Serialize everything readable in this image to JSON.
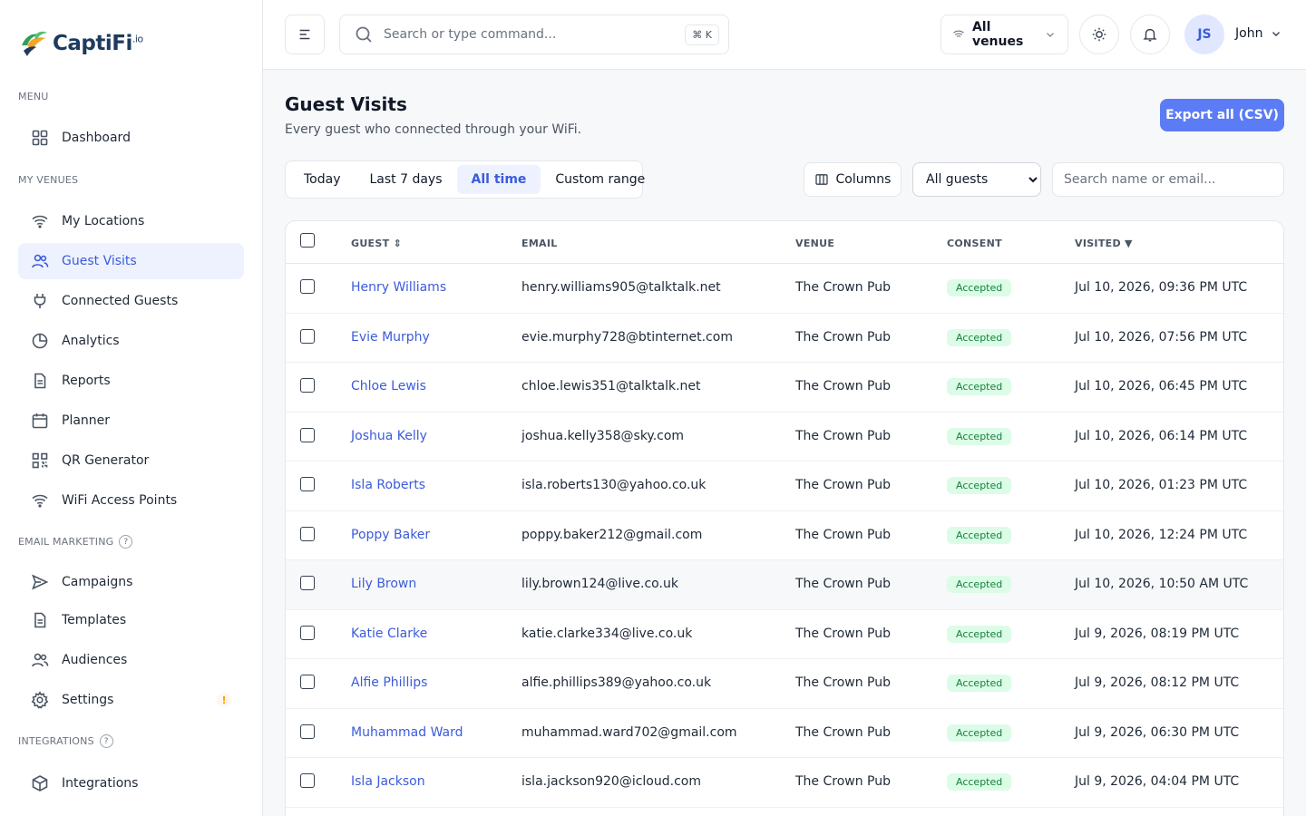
{
  "brand": {
    "name": "CaptiFi",
    "suffix": ".io"
  },
  "sidebar": {
    "menu_label": "MENU",
    "venues_label": "MY VENUES",
    "email_label": "EMAIL MARKETING",
    "integrations_label": "INTEGRATIONS",
    "help_glyph": "?",
    "items": [
      {
        "label": "Dashboard",
        "icon": "grid-icon"
      },
      {
        "label": "My Locations",
        "icon": "wifi-icon"
      },
      {
        "label": "Guest Visits",
        "icon": "users-icon",
        "active": true
      },
      {
        "label": "Connected Guests",
        "icon": "plug-icon"
      },
      {
        "label": "Analytics",
        "icon": "pie-chart-icon"
      },
      {
        "label": "Reports",
        "icon": "file-icon"
      },
      {
        "label": "Planner",
        "icon": "calendar-icon"
      },
      {
        "label": "QR Generator",
        "icon": "qr-icon"
      },
      {
        "label": "WiFi Access Points",
        "icon": "wifi-icon"
      },
      {
        "label": "Campaigns",
        "icon": "send-icon"
      },
      {
        "label": "Templates",
        "icon": "file-icon"
      },
      {
        "label": "Audiences",
        "icon": "users-icon"
      },
      {
        "label": "Settings",
        "icon": "gear-icon",
        "badge": "!"
      },
      {
        "label": "Integrations",
        "icon": "box-icon"
      }
    ]
  },
  "topbar": {
    "search_placeholder": "Search or type command...",
    "shortcut": "⌘ K",
    "venue": "All venues",
    "avatar_initials": "JS",
    "user_name": "John"
  },
  "page": {
    "title": "Guest Visits",
    "subtitle": "Every guest who connected through your WiFi.",
    "export_label": "Export all (CSV)"
  },
  "filters": {
    "ranges": [
      "Today",
      "Last 7 days",
      "All time",
      "Custom range"
    ],
    "active_range": "All time",
    "columns_label": "Columns",
    "guest_filter": "All guests",
    "search_placeholder": "Search name or email..."
  },
  "table": {
    "headers": {
      "guest": "GUEST",
      "guest_sort": "⇕",
      "email": "EMAIL",
      "venue": "VENUE",
      "consent": "CONSENT",
      "visited": "VISITED",
      "visited_sort": "▼"
    },
    "rows": [
      {
        "name": "Henry Williams",
        "email": "henry.williams905@talktalk.net",
        "venue": "The Crown Pub",
        "consent": "Accepted",
        "visited": "Jul 10, 2026, 09:36 PM UTC"
      },
      {
        "name": "Evie Murphy",
        "email": "evie.murphy728@btinternet.com",
        "venue": "The Crown Pub",
        "consent": "Accepted",
        "visited": "Jul 10, 2026, 07:56 PM UTC"
      },
      {
        "name": "Chloe Lewis",
        "email": "chloe.lewis351@talktalk.net",
        "venue": "The Crown Pub",
        "consent": "Accepted",
        "visited": "Jul 10, 2026, 06:45 PM UTC"
      },
      {
        "name": "Joshua Kelly",
        "email": "joshua.kelly358@sky.com",
        "venue": "The Crown Pub",
        "consent": "Accepted",
        "visited": "Jul 10, 2026, 06:14 PM UTC"
      },
      {
        "name": "Isla Roberts",
        "email": "isla.roberts130@yahoo.co.uk",
        "venue": "The Crown Pub",
        "consent": "Accepted",
        "visited": "Jul 10, 2026, 01:23 PM UTC"
      },
      {
        "name": "Poppy Baker",
        "email": "poppy.baker212@gmail.com",
        "venue": "The Crown Pub",
        "consent": "Accepted",
        "visited": "Jul 10, 2026, 12:24 PM UTC"
      },
      {
        "name": "Lily Brown",
        "email": "lily.brown124@live.co.uk",
        "venue": "The Crown Pub",
        "consent": "Accepted",
        "visited": "Jul 10, 2026, 10:50 AM UTC"
      },
      {
        "name": "Katie Clarke",
        "email": "katie.clarke334@live.co.uk",
        "venue": "The Crown Pub",
        "consent": "Accepted",
        "visited": "Jul 9, 2026, 08:19 PM UTC"
      },
      {
        "name": "Alfie Phillips",
        "email": "alfie.phillips389@yahoo.co.uk",
        "venue": "The Crown Pub",
        "consent": "Accepted",
        "visited": "Jul 9, 2026, 08:12 PM UTC"
      },
      {
        "name": "Muhammad Ward",
        "email": "muhammad.ward702@gmail.com",
        "venue": "The Crown Pub",
        "consent": "Accepted",
        "visited": "Jul 9, 2026, 06:30 PM UTC"
      },
      {
        "name": "Isla Jackson",
        "email": "isla.jackson920@icloud.com",
        "venue": "The Crown Pub",
        "consent": "Accepted",
        "visited": "Jul 9, 2026, 04:04 PM UTC"
      }
    ]
  },
  "colors": {
    "accent": "#3b5bdb",
    "button": "#5b7cf5",
    "consent_bg": "#dcfce7",
    "consent_fg": "#15803d"
  }
}
